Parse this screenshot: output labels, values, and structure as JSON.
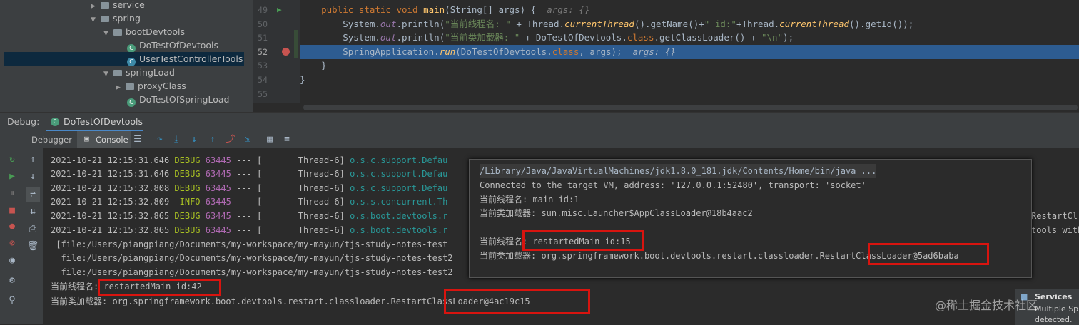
{
  "project_tree": {
    "items": [
      {
        "label": "service",
        "kind": "folder",
        "expanded": false
      },
      {
        "label": "spring",
        "kind": "folder",
        "expanded": true
      },
      {
        "label": "bootDevtools",
        "kind": "folder",
        "expanded": true
      },
      {
        "label": "DoTestOfDevtools",
        "kind": "class"
      },
      {
        "label": "UserTestControllerTools",
        "kind": "class",
        "selected": true
      },
      {
        "label": "springLoad",
        "kind": "folder",
        "expanded": true
      },
      {
        "label": "proxyClass",
        "kind": "folder",
        "expanded": false
      },
      {
        "label": "DoTestOfSpringLoad",
        "kind": "class"
      }
    ]
  },
  "editor": {
    "line_numbers": [
      "49",
      "50",
      "51",
      "52",
      "53",
      "54",
      "55"
    ],
    "code": {
      "l49_mods": "public static void ",
      "l49_name": "main",
      "l49_sig": "(String[] args) {  ",
      "l49_hint": "args: {}",
      "l50_a": "System.",
      "l50_out": "out",
      "l50_b": ".println(",
      "l50_s1": "\"当前线程名: \"",
      "l50_c": " + Thread.",
      "l50_m1": "currentThread",
      "l50_d": "().getName()+",
      "l50_s2": "\" id:\"",
      "l50_e": "+Thread.",
      "l50_m2": "currentThread",
      "l50_f": "().getId());",
      "l51_a": "System.",
      "l51_out": "out",
      "l51_b": ".println(",
      "l51_s1": "\"当前类加载器: \"",
      "l51_c": " + DoTestOfDevtools.",
      "l51_cls": "class",
      "l51_d": ".getClassLoader() + ",
      "l51_s2": "\"\\n\"",
      "l51_e": ");",
      "l52_a": "SpringApplication.",
      "l52_run": "run",
      "l52_b": "(DoTestOfDevtools.",
      "l52_cls": "class",
      "l52_c": ", args);  ",
      "l52_hint": "args: {}",
      "l53": "}",
      "l54": "}"
    }
  },
  "debug": {
    "label": "Debug:",
    "session_tab": "DoTestOfDevtools",
    "tabs": [
      "Debugger",
      "Console"
    ]
  },
  "console": {
    "log_lines": [
      {
        "ts": "2021-10-21 12:15:31.646",
        "level": "DEBUG",
        "pid": "63445",
        "sep": " --- [",
        "thread": "       Thread-6]",
        "logger": " o.s.c.support.Defau"
      },
      {
        "ts": "2021-10-21 12:15:31.646",
        "level": "DEBUG",
        "pid": "63445",
        "sep": " --- [",
        "thread": "       Thread-6]",
        "logger": " o.s.c.support.Defau"
      },
      {
        "ts": "2021-10-21 12:15:32.808",
        "level": "DEBUG",
        "pid": "63445",
        "sep": " --- [",
        "thread": "       Thread-6]",
        "logger": " o.s.c.support.Defau"
      },
      {
        "ts": "2021-10-21 12:15:32.809",
        "level": " INFO",
        "pid": "63445",
        "sep": " --- [",
        "thread": "       Thread-6]",
        "logger": " o.s.s.concurrent.Th"
      },
      {
        "ts": "2021-10-21 12:15:32.865",
        "level": "DEBUG",
        "pid": "63445",
        "sep": " --- [",
        "thread": "       Thread-6]",
        "logger": " o.s.boot.devtools.r"
      },
      {
        "ts": "2021-10-21 12:15:32.865",
        "level": "DEBUG",
        "pid": "63445",
        "sep": " --- [",
        "thread": "       Thread-6]",
        "logger": " o.s.boot.devtools.r"
      }
    ],
    "file_lines": [
      " [file:/Users/piangpiang/Documents/my-workspace/my-mayun/tjs-study-notes-test",
      "  file:/Users/piangpiang/Documents/my-workspace/my-mayun/tjs-study-notes-test2",
      "  file:/Users/piangpiang/Documents/my-workspace/my-mayun/tjs-study-notes-test2"
    ],
    "right_clip_1": "RestartCl",
    "right_clip_2": "tools with",
    "thread_label": "当前线程名: ",
    "thread_value": "restartedMain id:42",
    "loader_label": "当前类加载器: ",
    "loader_value": "org.springframework.boot.devtools.restart.classloader.RestartClassLoader@4ac19c15"
  },
  "overlay": {
    "cmd": "/Library/Java/JavaVirtualMachines/jdk1.8.0_181.jdk/Contents/Home/bin/java ...",
    "connected": "Connected to the target VM, address: '127.0.0.1:52480', transport: 'socket'",
    "thread1_label": "当前线程名: ",
    "thread1_value": "main id:1",
    "loader1_label": "当前类加载器: ",
    "loader1_value": "sun.misc.Launcher$AppClassLoader@18b4aac2",
    "thread2_label": "当前线程名: ",
    "thread2_value": "restartedMain id:15",
    "loader2_label": "当前类加载器: ",
    "loader2_value": "org.springframework.boot.devtools.restart.classloader.RestartClassLoader@5ad6baba"
  },
  "services": {
    "title": "Services",
    "line1": "Multiple Sp",
    "line2": "detected."
  },
  "watermark": "@稀土掘金技术社区",
  "colors": {
    "highlight": "#2d5c91",
    "redbox": "#d8140f",
    "keyword": "#cc7832",
    "string": "#6a8759"
  }
}
